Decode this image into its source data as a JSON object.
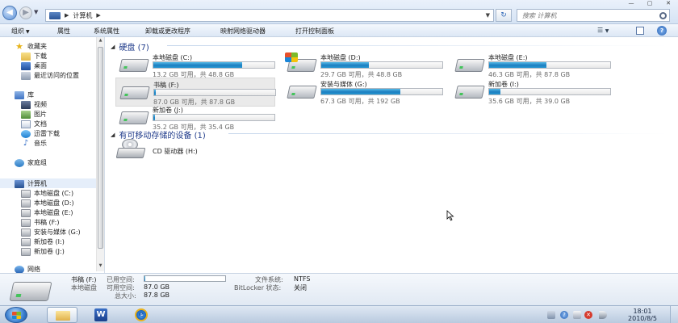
{
  "window": {
    "min_label": "—",
    "max_label": "▢",
    "close_label": "✕"
  },
  "address": {
    "crumb": "计算机",
    "search_placeholder": "搜索 计算机"
  },
  "toolbar": {
    "organize": "组织",
    "properties": "属性",
    "system_properties": "系统属性",
    "uninstall": "卸载或更改程序",
    "map_drive": "映射网络驱动器",
    "control_panel": "打开控制面板"
  },
  "sidebar": {
    "favorites": "收藏夹",
    "downloads": "下载",
    "desktop": "桌面",
    "recent": "最近访问的位置",
    "libraries": "库",
    "videos": "视频",
    "pictures": "图片",
    "documents": "文档",
    "xunlei": "迅雷下载",
    "music": "音乐",
    "homegroup": "家庭组",
    "computer": "计算机",
    "drives": [
      "本地磁盘 (C:)",
      "本地磁盘 (D:)",
      "本地磁盘 (E:)",
      "书稿 (F:)",
      "安装与媒体 (G:)",
      "新加卷 (I:)",
      "新加卷 (J:)"
    ],
    "network": "网络"
  },
  "main": {
    "hard_disks_header": "硬盘 (7)",
    "removable_header": "有可移动存储的设备 (1)",
    "drives": [
      {
        "name": "本地磁盘 (C:)",
        "info": "13.2 GB 可用，共 48.8 GB",
        "used_fraction": 0.73
      },
      {
        "name": "本地磁盘 (D:)",
        "info": "29.7 GB 可用，共 48.8 GB",
        "used_fraction": 0.39
      },
      {
        "name": "本地磁盘 (E:)",
        "info": "46.3 GB 可用，共 87.8 GB",
        "used_fraction": 0.47
      },
      {
        "name": "书稿 (F:)",
        "info": "87.0 GB 可用，共 87.8 GB",
        "used_fraction": 0.01
      },
      {
        "name": "安装与媒体 (G:)",
        "info": "67.3 GB 可用，共 192 GB",
        "used_fraction": 0.65
      },
      {
        "name": "新加卷 (I:)",
        "info": "35.6 GB 可用，共 39.0 GB",
        "used_fraction": 0.09
      },
      {
        "name": "新加卷 (J:)",
        "info": "35.2 GB 可用，共 35.4 GB",
        "used_fraction": 0.01
      }
    ],
    "cd_drive": "CD 驱动器 (H:)"
  },
  "details": {
    "drive_name": "书稿 (F:)",
    "used_label": "已用空间:",
    "drive_type": "本地磁盘",
    "free_label": "可用空间:",
    "free_value": "87.0 GB",
    "total_label": "总大小:",
    "total_value": "87.8 GB",
    "fs_label": "文件系统:",
    "fs_value": "NTFS",
    "bitlocker_label": "BitLocker 状态:",
    "bitlocker_value": "关闭",
    "used_fraction": 0.01
  },
  "taskbar": {
    "time": "18:01",
    "date": "2010/8/5"
  },
  "colors": {
    "accent": "#1e3a8a",
    "bar_fill": "#1d7fc0"
  }
}
